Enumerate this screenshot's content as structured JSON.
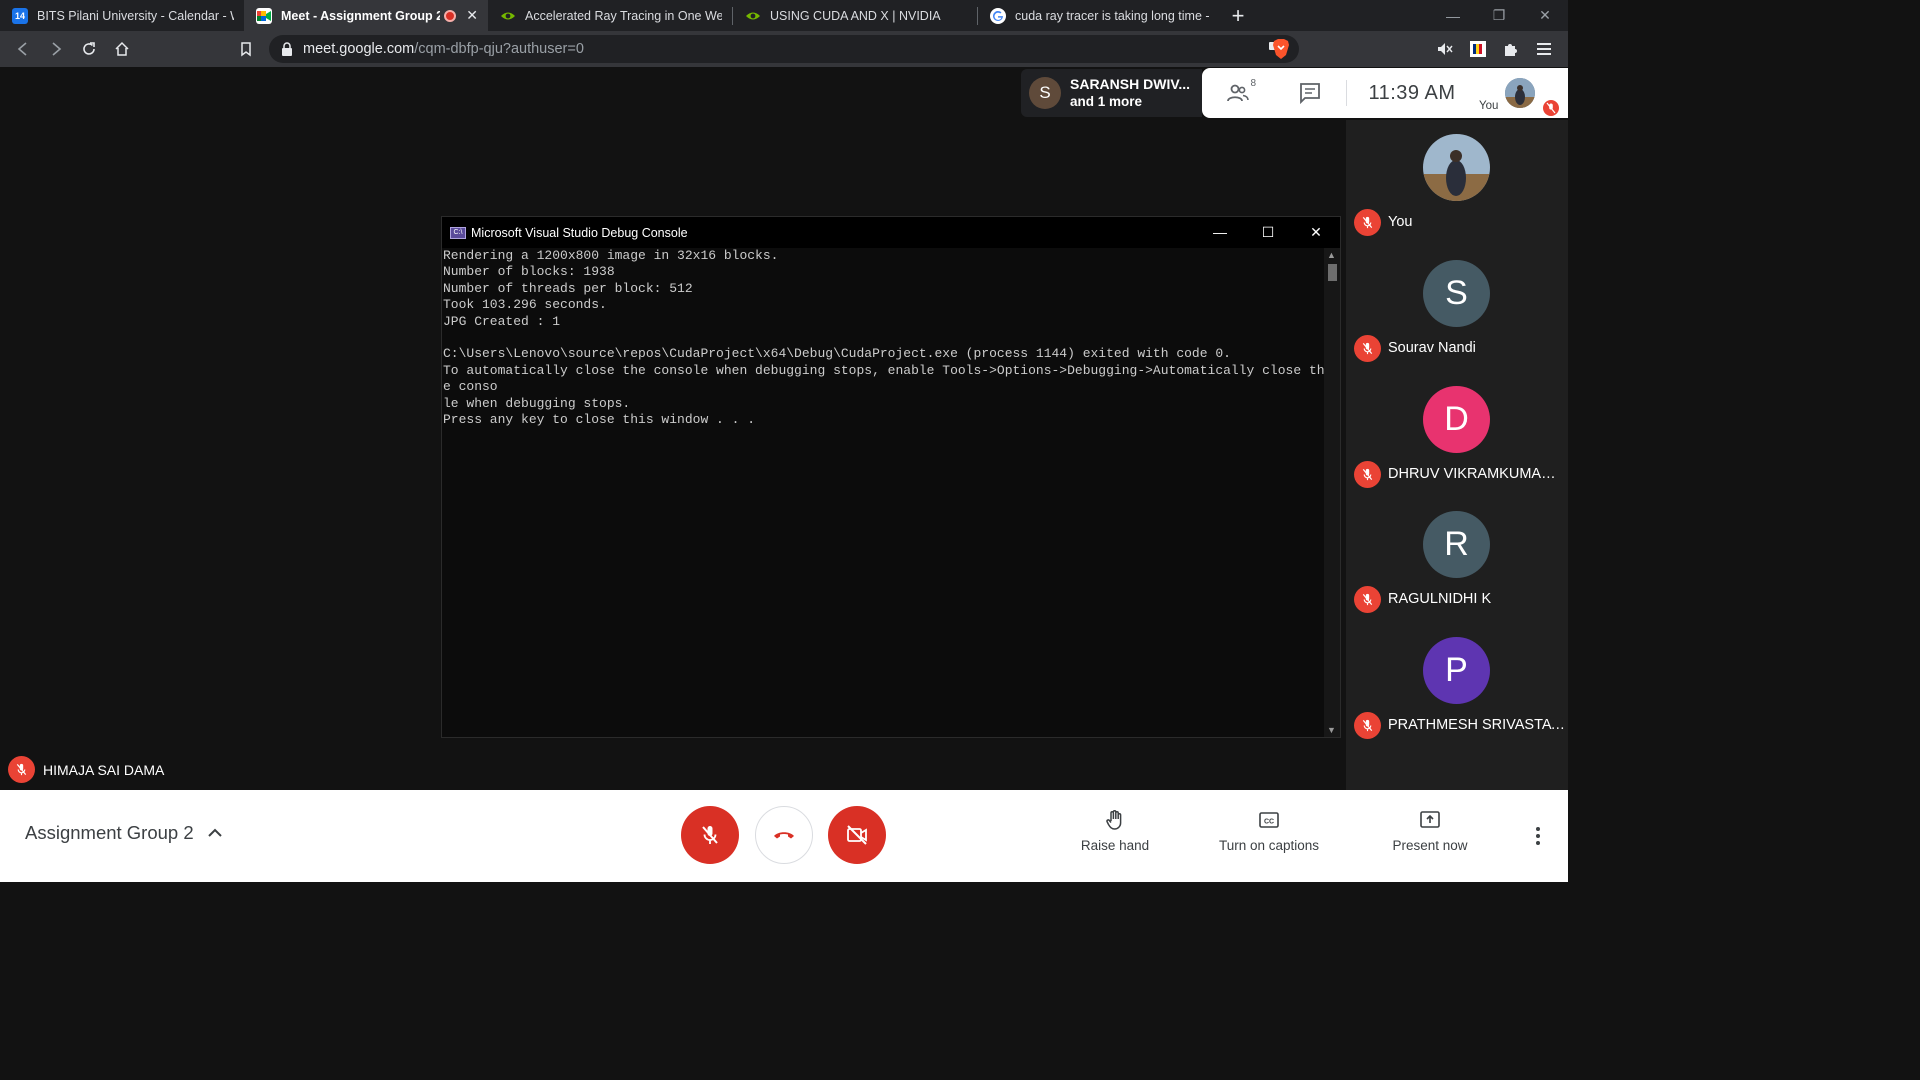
{
  "browser": {
    "tabs": [
      {
        "title": "BITS Pilani University - Calendar - Wee",
        "favicon": "calendar-icon",
        "favicon_text": "14",
        "color": "#1a73e8",
        "active": false
      },
      {
        "title": "Meet - Assignment Group 2",
        "favicon": "meet-icon",
        "color": "#00832d",
        "active": true,
        "recording": true
      },
      {
        "title": "Accelerated Ray Tracing in One Weeke",
        "favicon": "nvidia-icon",
        "color": "#76b900",
        "active": false
      },
      {
        "title": "USING CUDA AND X | NVIDIA",
        "favicon": "nvidia-icon",
        "color": "#76b900",
        "active": false
      },
      {
        "title": "cuda ray tracer is taking long time - G",
        "favicon": "google-icon",
        "color": "#ffffff",
        "active": false
      }
    ],
    "url_host": "meet.google.com",
    "url_path": "/cqm-dbfp-qju?authuser=0"
  },
  "meet": {
    "presenter": {
      "initial": "S",
      "name": "SARANSH DWIV...",
      "more": "and 1 more"
    },
    "people_count": "8",
    "clock": "11:39  AM",
    "you_label": "You",
    "console": {
      "title": "Microsoft Visual Studio Debug Console",
      "icon_text": "C:\\",
      "output": "Rendering a 1200x800 image in 32x16 blocks.\nNumber of blocks: 1938\nNumber of threads per block: 512\nTook 103.296 seconds.\nJPG Created : 1\n\nC:\\Users\\Lenovo\\source\\repos\\CudaProject\\x64\\Debug\\CudaProject.exe (process 1144) exited with code 0.\nTo automatically close the console when debugging stops, enable Tools->Options->Debugging->Automatically close the conso\nle when debugging stops.\nPress any key to close this window . . ."
    },
    "participants": [
      {
        "name": "You",
        "initial": "",
        "color": "photo",
        "muted": true
      },
      {
        "name": "Sourav Nandi",
        "initial": "S",
        "color": "#455a64",
        "muted": true
      },
      {
        "name": "DHRUV VIKRAMKUMAR ...",
        "initial": "D",
        "color": "#e8336f",
        "muted": true
      },
      {
        "name": "RAGULNIDHI K",
        "initial": "R",
        "color": "#455a64",
        "muted": true
      },
      {
        "name": "PRATHMESH SRIVASTAVA",
        "initial": "P",
        "color": "#5e35b1",
        "muted": true
      }
    ],
    "main_speaker": "HIMAJA SAI DAMA",
    "meeting_title": "Assignment Group 2",
    "actions": {
      "raise_hand": "Raise hand",
      "captions": "Turn on captions",
      "present": "Present now"
    }
  }
}
